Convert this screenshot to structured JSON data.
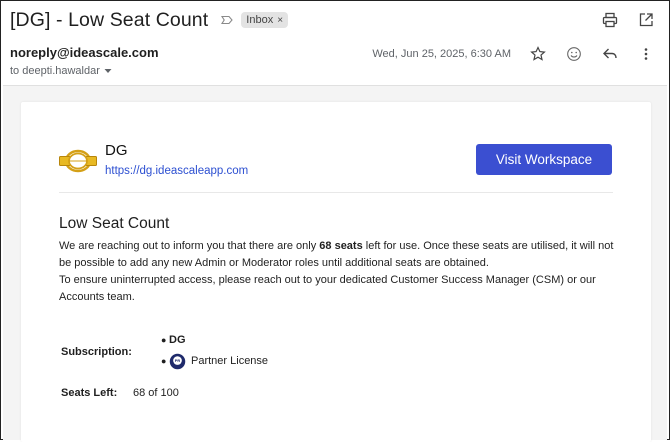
{
  "header": {
    "subject": "[DG] - Low Seat Count",
    "label_chip": "Inbox",
    "label_chip_close": "×"
  },
  "sender": {
    "email": "noreply@ideascale.com",
    "to": "to deepti.hawaldar",
    "date": "Wed, Jun 25, 2025, 6:30 AM"
  },
  "icons": {
    "print": "printer-icon",
    "open_new": "open-in-new-window-icon",
    "star": "star-icon",
    "emoji": "emoji-icon",
    "reply": "reply-icon",
    "more": "more-vertical-icon",
    "label": "label-icon",
    "dropdown": "chevron-down-icon"
  },
  "email": {
    "brand_name": "DG",
    "brand_url": "https://dg.ideascaleapp.com",
    "visit_button": "Visit Workspace",
    "title": "Low Seat Count",
    "paragraph1_before": "We are reaching out to inform you that there are only ",
    "paragraph1_bold": "68 seats",
    "paragraph1_after": " left for use. Once these seats are utilised, it will not be possible to add any new Admin or Moderator roles until additional seats are obtained.",
    "paragraph2": "To ensure uninterrupted access, please reach out to your dedicated Customer Success Manager (CSM) or our Accounts team.",
    "subscription_label": "Subscription:",
    "subscription_items": [
      "DG",
      "Partner License"
    ],
    "partner_badge_text": "PR",
    "seats_label": "Seats Left:",
    "seats_value": "68 of 100"
  },
  "colors": {
    "button_bg": "#3b4fd1",
    "link": "#2c4fd1",
    "badge": "#1f2a6b",
    "logo_gold": "#d4a017"
  }
}
